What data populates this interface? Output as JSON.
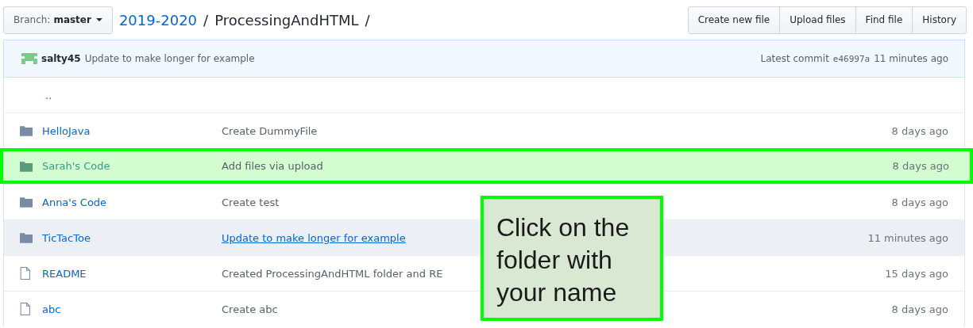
{
  "branch": {
    "label": "Branch:",
    "value": "master"
  },
  "breadcrumb": {
    "parent": "2019-2020",
    "current": "ProcessingAndHTML",
    "separator": "/"
  },
  "buttons": [
    "Create new file",
    "Upload files",
    "Find file",
    "History"
  ],
  "latest_commit": {
    "author": "salty45",
    "message": "Update to make longer for example",
    "label": "Latest commit",
    "sha": "e46997a",
    "age": "11 minutes ago"
  },
  "parent_link": "..",
  "rows": [
    {
      "kind": "folder",
      "name": "HelloJava",
      "message": "Create DummyFile",
      "message_link": false,
      "age": "8 days ago",
      "highlighted": false,
      "hovered": false
    },
    {
      "kind": "folder",
      "name": "Sarah's Code",
      "message": "Add files via upload",
      "message_link": false,
      "age": "8 days ago",
      "highlighted": true,
      "hovered": false
    },
    {
      "kind": "folder",
      "name": "Anna's Code",
      "message": "Create test",
      "message_link": false,
      "age": "8 days ago",
      "highlighted": false,
      "hovered": false
    },
    {
      "kind": "folder",
      "name": "TicTacToe",
      "message": "Update to make longer for example",
      "message_link": true,
      "age": "11 minutes ago",
      "highlighted": false,
      "hovered": true
    },
    {
      "kind": "file",
      "name": "README",
      "message": "Created ProcessingAndHTML folder and RE",
      "message_link": false,
      "age": "15 days ago",
      "highlighted": false,
      "hovered": false
    },
    {
      "kind": "file",
      "name": "abc",
      "message": "Create abc",
      "message_link": false,
      "age": "8 days ago",
      "highlighted": false,
      "hovered": false
    }
  ],
  "callout": "Click on the folder with your name"
}
